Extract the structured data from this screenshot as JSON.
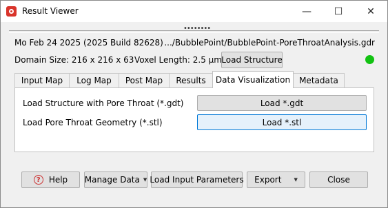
{
  "window": {
    "title": "Result Viewer"
  },
  "info": {
    "date": "Mo Feb 24 2025 (2025 Build 82628)",
    "path": ".../BubblePoint/BubblePoint-PoreThroatAnalysis.gdr",
    "domain_size": "Domain Size: 216 x 216 x 63",
    "voxel_length": "Voxel Length: 2.5 µm",
    "load_structure_label": "Load Structure",
    "status_color": "#12c212"
  },
  "tabs": [
    {
      "label": "Input Map"
    },
    {
      "label": "Log Map"
    },
    {
      "label": "Post Map"
    },
    {
      "label": "Results"
    },
    {
      "label": "Data Visualization",
      "active": true
    },
    {
      "label": "Metadata"
    }
  ],
  "panel": {
    "row1_label": "Load Structure with Pore Throat (*.gdt)",
    "row1_button": "Load *.gdt",
    "row2_label": "Load Pore Throat Geometry (*.stl)",
    "row2_button": "Load *.stl"
  },
  "footer": {
    "help": "Help",
    "manage_data": "Manage Data",
    "load_input_parameters": "Load Input Parameters",
    "export": "Export",
    "close": "Close"
  }
}
